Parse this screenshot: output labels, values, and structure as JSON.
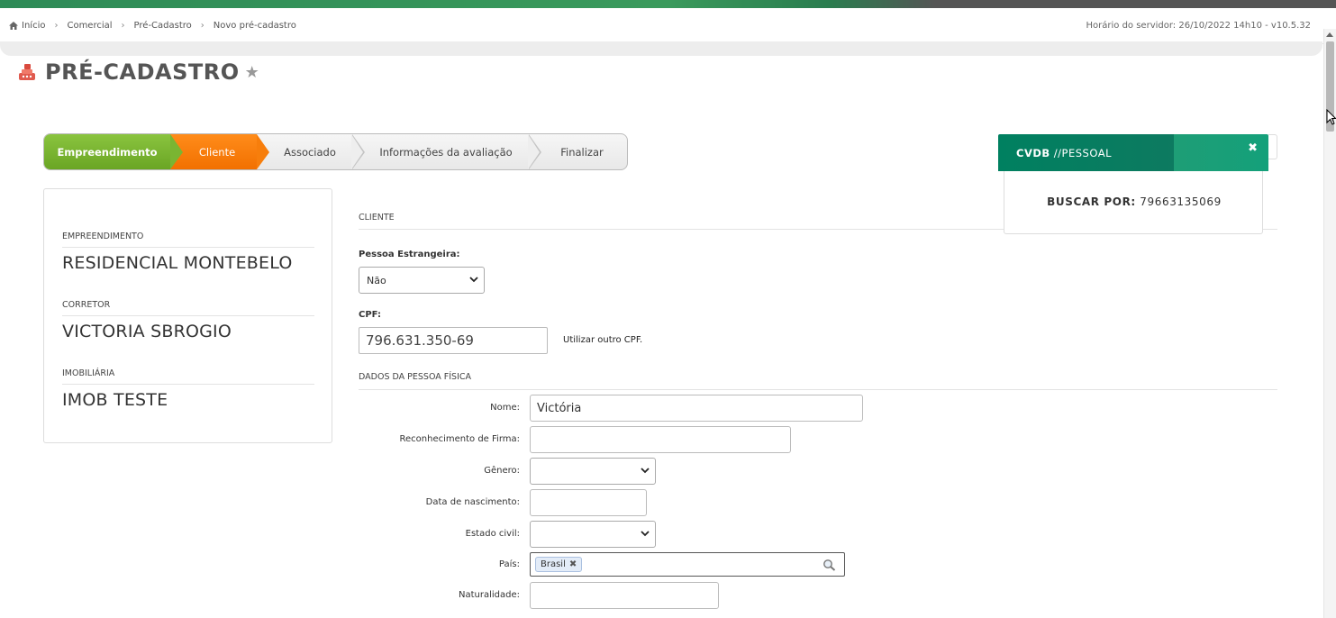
{
  "breadcrumb": {
    "items": [
      "Início",
      "Comercial",
      "Pré-Cadastro",
      "Novo pré-cadastro"
    ]
  },
  "server_time": "Horário do servidor: 26/10/2022 14h10 - v10.5.32",
  "page": {
    "title": "PRÉ-CADASTRO"
  },
  "wizard": {
    "steps": [
      "Empreendimento",
      "Cliente",
      "Associado",
      "Informações da avaliação",
      "Finalizar"
    ],
    "active_step": "Cliente",
    "colors": {
      "done": "#7ab532",
      "active": "#f77e0c"
    }
  },
  "summary": {
    "empreendimento_label": "EMPREENDIMENTO",
    "empreendimento_value": "RESIDENCIAL MONTEBELO",
    "corretor_label": "CORRETOR",
    "corretor_value": "VICTORIA SBROGIO",
    "imobiliaria_label": "IMOBILIÁRIA",
    "imobiliaria_value": "IMOB TESTE"
  },
  "form": {
    "section_cliente": "CLIENTE",
    "pessoa_estrangeira_label": "Pessoa Estrangeira:",
    "pessoa_estrangeira_value": "Não",
    "cpf_label": "CPF:",
    "cpf_value": "796.631.350-69",
    "outro_cpf_link": "Utilizar outro CPF.",
    "section_pf": "DADOS DA PESSOA FÍSICA",
    "nome_label": "Nome:",
    "nome_value": "Victória",
    "firma_label": "Reconhecimento de Firma:",
    "firma_value": "",
    "genero_label": "Gênero:",
    "genero_value": "",
    "nascimento_label": "Data de nascimento:",
    "nascimento_value": "",
    "estado_civil_label": "Estado civil:",
    "estado_civil_value": "",
    "pais_label": "País:",
    "pais_tag": "Brasil",
    "naturalidade_label": "Naturalidade:",
    "naturalidade_value": ""
  },
  "popup": {
    "title_bold": "CVDB",
    "title_light": " //PESSOAL",
    "search_label": "BUSCAR POR:",
    "search_value": "79663135069",
    "colors": {
      "header": "#0d7a60"
    }
  }
}
